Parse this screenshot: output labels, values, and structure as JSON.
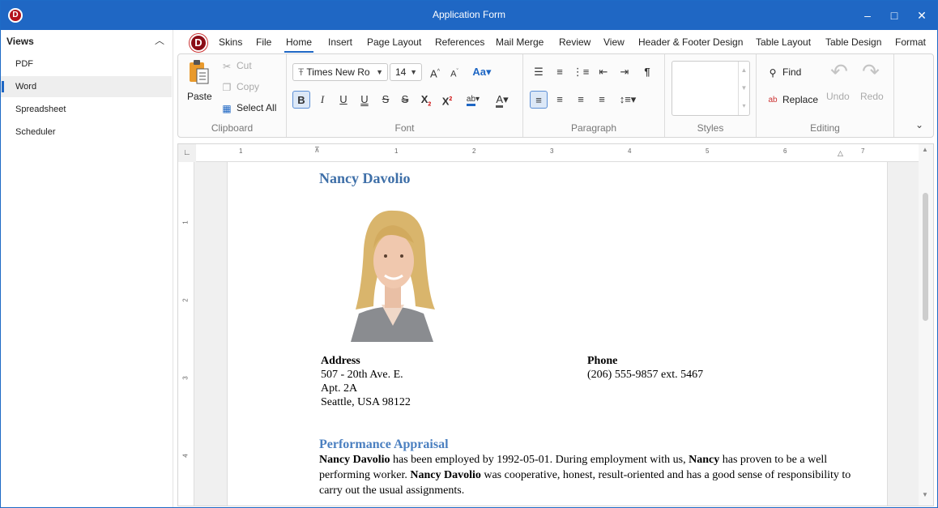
{
  "window": {
    "title": "Application Form",
    "minimize": "–",
    "maximize": "□",
    "close": "✕"
  },
  "sidebar": {
    "header": "Views",
    "items": [
      {
        "label": "PDF"
      },
      {
        "label": "Word"
      },
      {
        "label": "Spreadsheet"
      },
      {
        "label": "Scheduler"
      }
    ]
  },
  "ribbon": {
    "tabs": [
      "Skins",
      "File",
      "Home",
      "Insert",
      "Page Layout",
      "References",
      "Mail Merge",
      "Review",
      "View",
      "Header & Footer Design",
      "Table Layout",
      "Table Design",
      "Format"
    ],
    "active_tab": "Home",
    "clipboard": {
      "label": "Clipboard",
      "paste": "Paste",
      "cut": "Cut",
      "copy": "Copy",
      "select_all": "Select All"
    },
    "font": {
      "label": "Font",
      "font_name": "Times New Ro",
      "font_size": "14"
    },
    "paragraph": {
      "label": "Paragraph"
    },
    "styles": {
      "label": "Styles"
    },
    "editing": {
      "label": "Editing",
      "find": "Find",
      "replace": "Replace",
      "undo": "Undo",
      "redo": "Redo"
    }
  },
  "ruler": {
    "h_numbers": [
      "1",
      "1",
      "2",
      "3",
      "4",
      "5",
      "6",
      "7"
    ],
    "v_numbers": [
      "1",
      "2",
      "3",
      "4"
    ]
  },
  "document": {
    "name": "Nancy Davolio",
    "address_label": "Address",
    "address_lines": [
      "507 - 20th Ave. E.",
      "Apt. 2A",
      "Seattle, USA 98122"
    ],
    "phone_label": "Phone",
    "phone": "(206) 555-9857 ext. 5467",
    "section_title": "Performance Appraisal",
    "para_b1": "Nancy Davolio",
    "para_t1": " has been employed by 1992-05-01. During employment with us, ",
    "para_b2": "Nancy",
    "para_t2": " has proven to be a well performing worker. ",
    "para_b3": "Nancy Davolio",
    "para_t3": " was cooperative, honest, result-oriented and has a good sense of responsibility to carry out the usual assignments."
  }
}
